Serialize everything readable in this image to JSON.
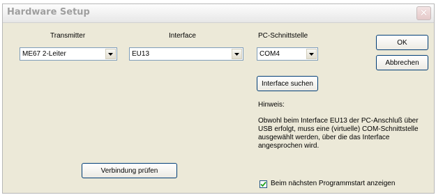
{
  "window": {
    "title": "Hardware Setup",
    "close_glyph": "✕"
  },
  "labels": {
    "transmitter": "Transmitter",
    "interface": "Interface",
    "pc_port": "PC-Schnittstelle"
  },
  "selects": {
    "transmitter": "ME67 2-Leiter",
    "interface": "EU13",
    "port": "COM4"
  },
  "buttons": {
    "ok": "OK",
    "cancel": "Abbrechen",
    "search_interface": "Interface suchen",
    "check_connection": "Verbindung prüfen"
  },
  "hint": {
    "title": "Hinweis:",
    "lines": [
      "Obwohl beim Interface EU13 der PC-Anschluß über",
      "USB erfolgt, muss eine (virtuelle) COM-Schnittstelle",
      "ausgewählt werden, über die das Interface",
      "angesprochen wird."
    ]
  },
  "checkbox": {
    "label": "Beim nächsten Programmstart anzeigen",
    "checked": true
  },
  "icons": {
    "dropdown": "chevron-down-icon",
    "close": "close-icon",
    "check": "checkmark-icon"
  }
}
